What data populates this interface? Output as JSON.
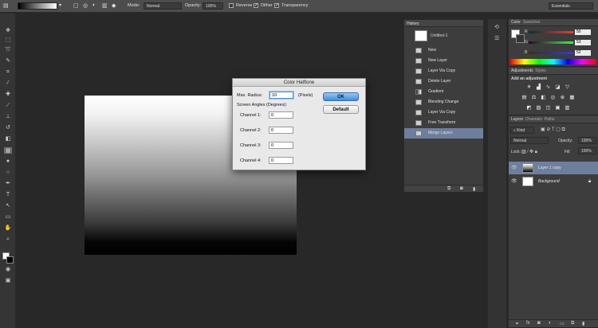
{
  "options_bar": {
    "mode_label": "Mode:",
    "mode_value": "Normal",
    "opacity_label": "Opacity:",
    "opacity_value": "100%",
    "reverse_label": "Reverse",
    "dither_label": "Dither",
    "transparency_label": "Transparency",
    "workspace_value": "Essentials"
  },
  "toolbar": {
    "tools": [
      "move-tool",
      "marquee-tool",
      "lasso-tool",
      "quick-select-tool",
      "crop-tool",
      "eyedropper-tool",
      "healing-tool",
      "brush-tool",
      "clone-stamp-tool",
      "history-brush-tool",
      "eraser-tool",
      "gradient-tool",
      "blur-tool",
      "dodge-tool",
      "pen-tool",
      "type-tool",
      "path-select-tool",
      "shape-tool",
      "hand-tool",
      "zoom-tool"
    ]
  },
  "dialog": {
    "title": "Color Halftone",
    "max_radius_label": "Max. Radius:",
    "max_radius_value": "10",
    "pixels_label": "(Pixels)",
    "screen_angles_label": "Screen Angles (Degrees):",
    "channels": [
      {
        "label": "Channel 1:",
        "value": "0"
      },
      {
        "label": "Channel 2:",
        "value": "0"
      },
      {
        "label": "Channel 3:",
        "value": "0"
      },
      {
        "label": "Channel 4:",
        "value": "0"
      }
    ],
    "ok_label": "OK",
    "default_label": "Default"
  },
  "history": {
    "tab_label": "History",
    "snapshot_name": "Untitled-1",
    "steps": [
      "New",
      "New Layer",
      "Layer Via Copy",
      "Delete Layer",
      "Gradient",
      "Blending Change",
      "Layer Via Copy",
      "Free Transform",
      "Merge Layers"
    ],
    "selected_index": 8
  },
  "color_panel": {
    "tab_color": "Color",
    "tab_swatches": "Swatches",
    "r_label": "R",
    "r_value": "50",
    "g_label": "G",
    "g_value": "53",
    "b_label": "B",
    "b_value": "52"
  },
  "adjustments_panel": {
    "tab_adjustments": "Adjustments",
    "tab_styles": "Styles",
    "hint": "Add an adjustment"
  },
  "layers_panel": {
    "tab_layers": "Layers",
    "tab_channels": "Channels",
    "tab_paths": "Paths",
    "kind_label": "Kind",
    "blend_value": "Normal",
    "opacity_label": "Opacity:",
    "opacity_value": "100%",
    "lock_label": "Lock:",
    "fill_label": "Fill:",
    "fill_value": "100%",
    "layers": [
      {
        "name": "Layer 1 copy",
        "selected": true
      },
      {
        "name": "Background",
        "selected": false
      }
    ]
  },
  "colors": {
    "selection": "#6e7f9e",
    "panel_bg": "#3d3d3d",
    "ok_button": "#3e8de0"
  }
}
